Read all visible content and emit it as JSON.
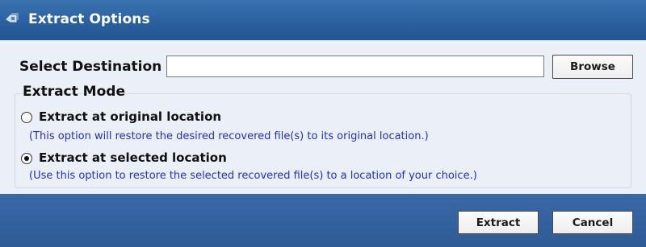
{
  "window": {
    "title": "Extract Options",
    "icon": "extract-app-icon"
  },
  "destination": {
    "label": "Select Destination :",
    "value": "",
    "placeholder": "",
    "browse_label": "Browse"
  },
  "extract_mode": {
    "legend": "Extract Mode",
    "options": [
      {
        "label": "Extract at original location",
        "description": "(This option will restore the desired recovered file(s) to its original location.)",
        "selected": false
      },
      {
        "label": "Extract at selected location",
        "description": "(Use this option to restore the selected recovered file(s) to a location of your choice.)",
        "selected": true
      }
    ]
  },
  "footer": {
    "extract_label": "Extract",
    "cancel_label": "Cancel"
  },
  "colors": {
    "titlebar": "#2b609f",
    "content_background": "#eaeff8",
    "footer": "#2e5b95",
    "description_text": "#2330c8"
  }
}
